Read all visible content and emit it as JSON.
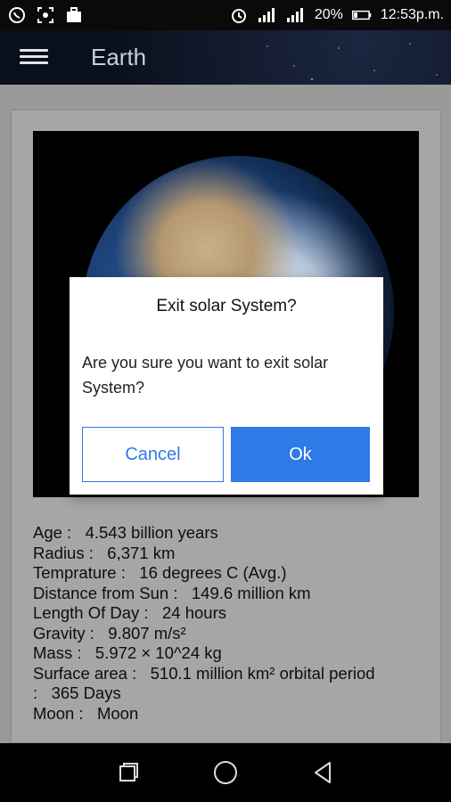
{
  "status_bar": {
    "battery": "20%",
    "time": "12:53p.m."
  },
  "app_bar": {
    "title": "Earth"
  },
  "planet": {
    "details": [
      {
        "label": "Age :",
        "value": "4.543 billion years"
      },
      {
        "label": "Radius :",
        "value": "6,371 km"
      },
      {
        "label": "Temprature :",
        "value": "16 degrees C (Avg.)"
      },
      {
        "label": "Distance from Sun :",
        "value": "149.6 million km"
      },
      {
        "label": "Length Of Day :",
        "value": "24 hours"
      },
      {
        "label": "Gravity :",
        "value": "9.807 m/s²"
      },
      {
        "label": "Mass :",
        "value": "5.972 × 10^24 kg"
      },
      {
        "label": "Surface area :",
        "value": "510.1 million km² orbital period"
      },
      {
        "label": ":",
        "value": "365 Days"
      },
      {
        "label": "Moon :",
        "value": "Moon"
      }
    ]
  },
  "dialog": {
    "title": "Exit solar System?",
    "message": "Are you sure you want to exit solar System?",
    "cancel_label": "Cancel",
    "ok_label": "Ok"
  },
  "colors": {
    "accent": "#2e7ae6",
    "scrim": "#9a9a9a"
  },
  "icons": {
    "status_left": [
      "whatsapp-icon",
      "screenshot-icon",
      "briefcase-icon"
    ],
    "status_right": [
      "alarm-icon",
      "signal-icon",
      "signal-icon",
      "battery-icon"
    ],
    "nav": [
      "recents-icon",
      "home-icon",
      "back-icon"
    ]
  }
}
